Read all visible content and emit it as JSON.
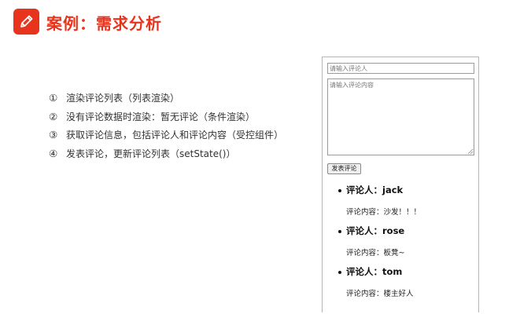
{
  "header": {
    "title": "案例：需求分析",
    "icon": "pencil-icon",
    "accent_color": "#e8341c"
  },
  "requirements": [
    {
      "num": "①",
      "text": "渲染评论列表（列表渲染）"
    },
    {
      "num": "②",
      "text": "没有评论数据时渲染：暂无评论（条件渲染）"
    },
    {
      "num": "③",
      "text": "获取评论信息，包括评论人和评论内容（受控组件）"
    },
    {
      "num": "④",
      "text": "发表评论，更新评论列表（setState()）"
    }
  ],
  "demo": {
    "name_placeholder": "请输入评论人",
    "content_placeholder": "请输入评论内容",
    "submit_label": "发表评论",
    "comments": [
      {
        "author": "评论人：jack",
        "content": "评论内容：沙发！！！"
      },
      {
        "author": "评论人：rose",
        "content": "评论内容：板凳~"
      },
      {
        "author": "评论人：tom",
        "content": "评论内容：楼主好人"
      }
    ]
  }
}
